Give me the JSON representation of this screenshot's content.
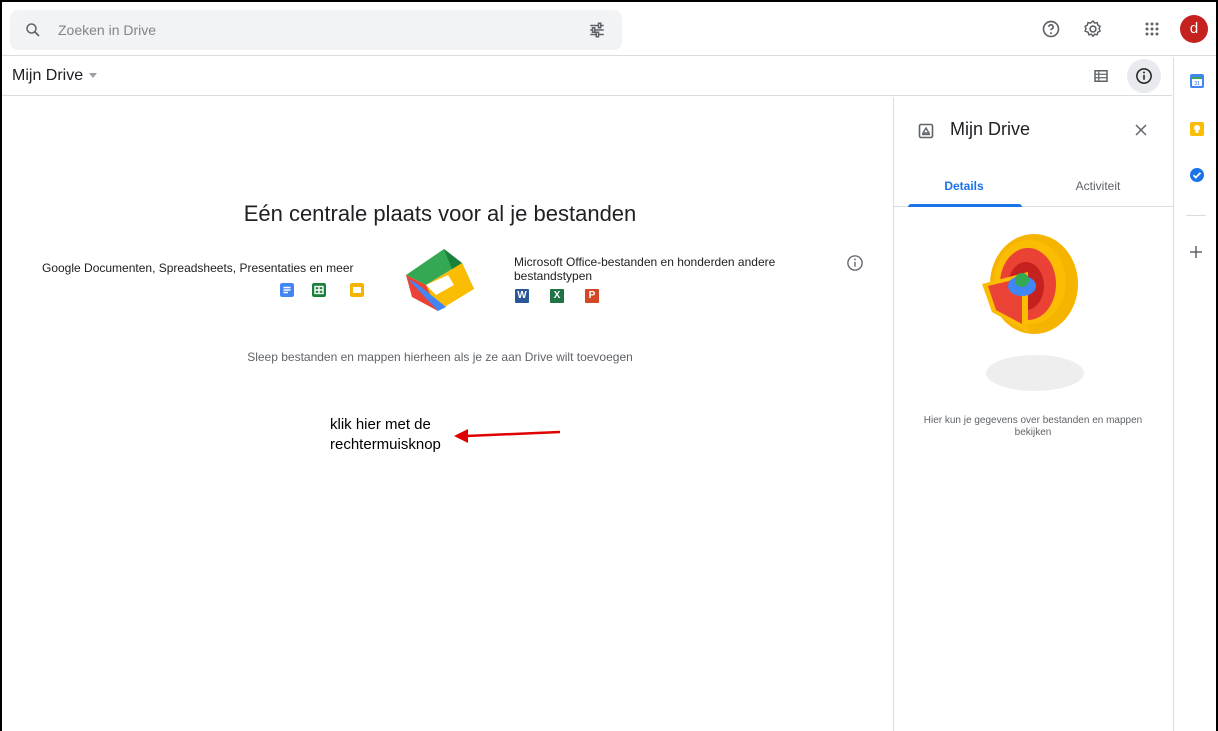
{
  "search": {
    "placeholder": "Zoeken in Drive"
  },
  "top_icons": [
    "search-icon",
    "tune-icon",
    "help-icon",
    "settings-icon",
    "apps-icon"
  ],
  "user": {
    "avatar_letter": "d",
    "avatar_color": "#c5221f"
  },
  "location": {
    "title": "Mijn Drive"
  },
  "main": {
    "headline": "Eén centrale plaats voor al je bestanden",
    "left_caption": "Google Documenten, Spreadsheets, Presentaties en meer",
    "right_caption": "Microsoft Office-bestanden en honderden andere bestandstypen",
    "ms_letters": {
      "word": "W",
      "excel": "X",
      "powerpoint": "P"
    },
    "drag_hint": "Sleep bestanden en mappen hierheen als je ze aan Drive wilt toevoegen"
  },
  "annotation": {
    "line1": "klik hier met de",
    "line2": "rechtermuisknop",
    "arrow_color": "#e00000"
  },
  "details_panel": {
    "title": "Mijn Drive",
    "tabs": [
      {
        "label": "Details",
        "active": true
      },
      {
        "label": "Activiteit",
        "active": false
      }
    ],
    "empty_text": "Hier kun je gegevens over bestanden en mappen bekijken"
  },
  "side_rail": [
    "calendar-icon",
    "keep-icon",
    "tasks-icon",
    "add-icon"
  ],
  "colors": {
    "accent": "#1a73e8",
    "search_bg": "#f1f3f4",
    "divider": "#dadce0"
  }
}
